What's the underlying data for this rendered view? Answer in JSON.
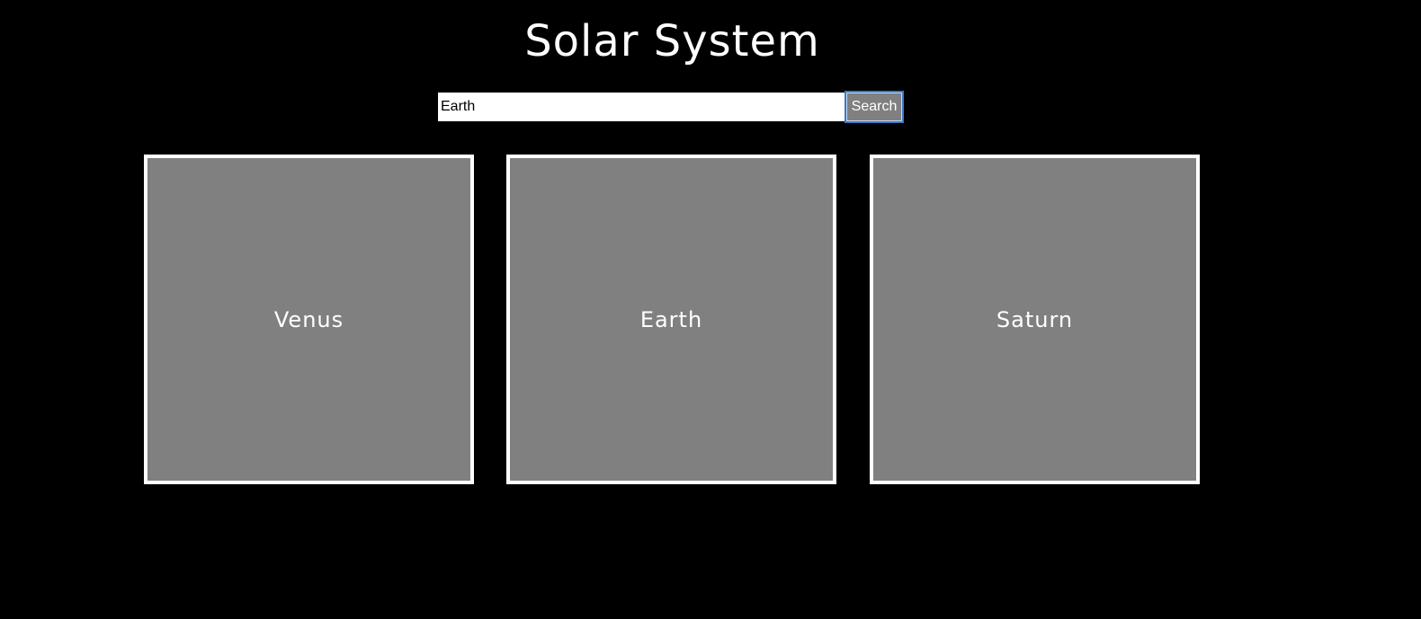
{
  "header": {
    "title": "Solar System"
  },
  "search": {
    "value": "Earth",
    "button_label": "Search"
  },
  "planets": [
    {
      "name": "Venus"
    },
    {
      "name": "Earth"
    },
    {
      "name": "Saturn"
    }
  ],
  "colors": {
    "background": "#000000",
    "card_fill": "#808080",
    "card_border": "#ffffff",
    "text": "#ffffff",
    "button_focus_ring": "#3b78c9"
  }
}
